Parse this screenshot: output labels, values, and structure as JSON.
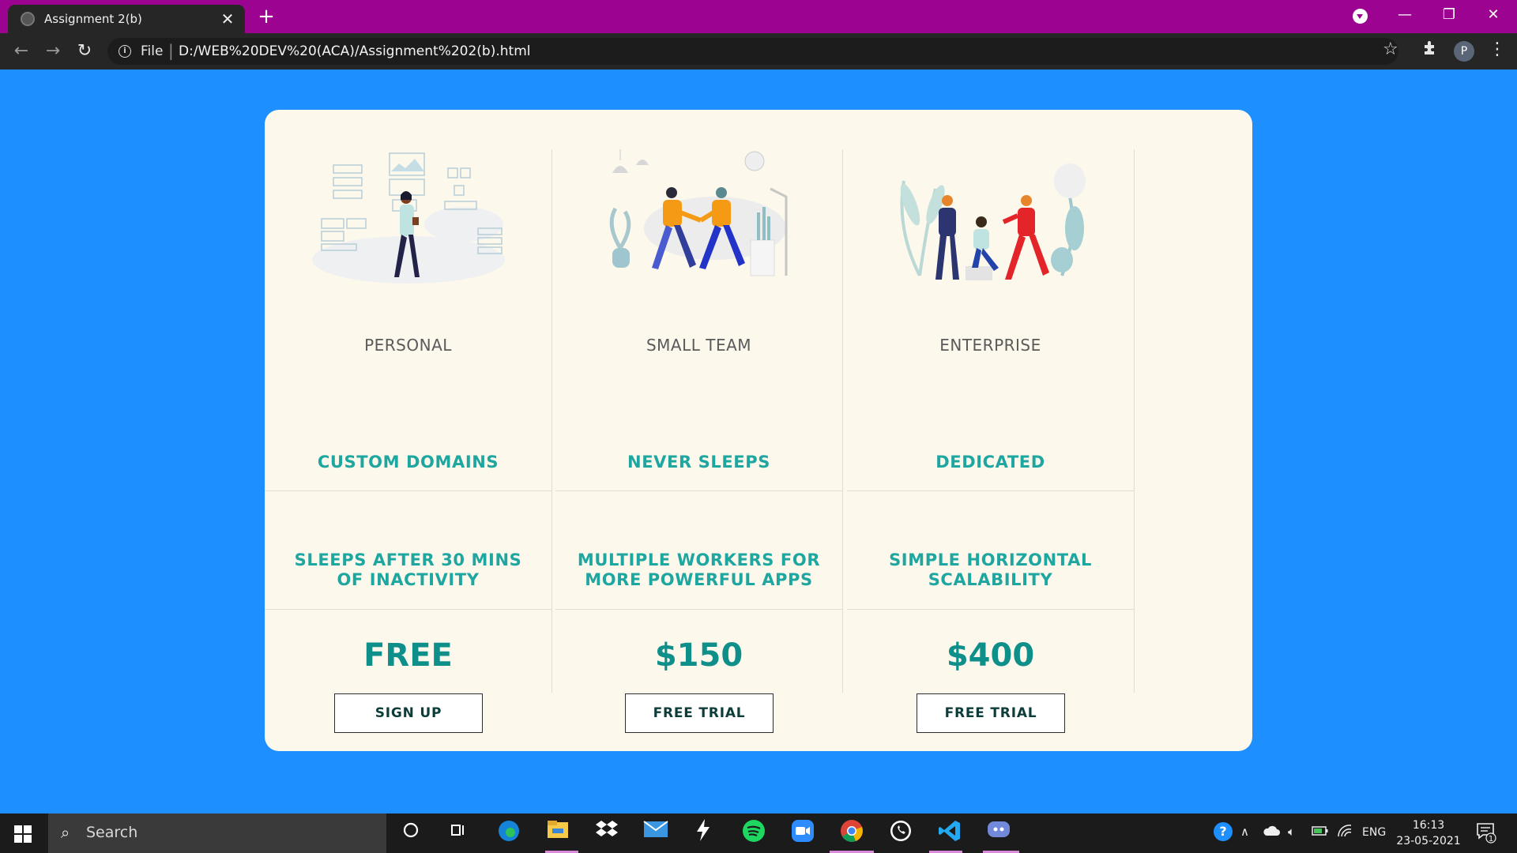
{
  "browser": {
    "tab_title": "Assignment 2(b)",
    "tab_close": "✕",
    "new_tab": "+",
    "omnibox_scheme": "File",
    "omnibox_url": "D:/WEB%20DEV%20(ACA)/Assignment%202(b).html",
    "avatar_letter": "P",
    "accent_color": "#9b0390"
  },
  "page": {
    "background_color": "#1e8fff",
    "plans": [
      {
        "name": "PERSONAL",
        "feature1": "CUSTOM DOMAINS",
        "feature2": "SLEEPS AFTER 30 MINS OF INACTIVITY",
        "price": "FREE",
        "cta": "SIGN UP"
      },
      {
        "name": "SMALL TEAM",
        "feature1": "NEVER SLEEPS",
        "feature2": "MULTIPLE WORKERS FOR MORE POWERFUL APPS",
        "price": "$150",
        "cta": "FREE TRIAL"
      },
      {
        "name": "ENTERPRISE",
        "feature1": "DEDICATED",
        "feature2": "SIMPLE HORIZONTAL SCALABILITY",
        "price": "$400",
        "cta": "FREE TRIAL"
      }
    ]
  },
  "taskbar": {
    "search_placeholder": "Search",
    "language": "ENG",
    "time": "16:13",
    "date": "23-05-2021",
    "notification_count": "1"
  }
}
